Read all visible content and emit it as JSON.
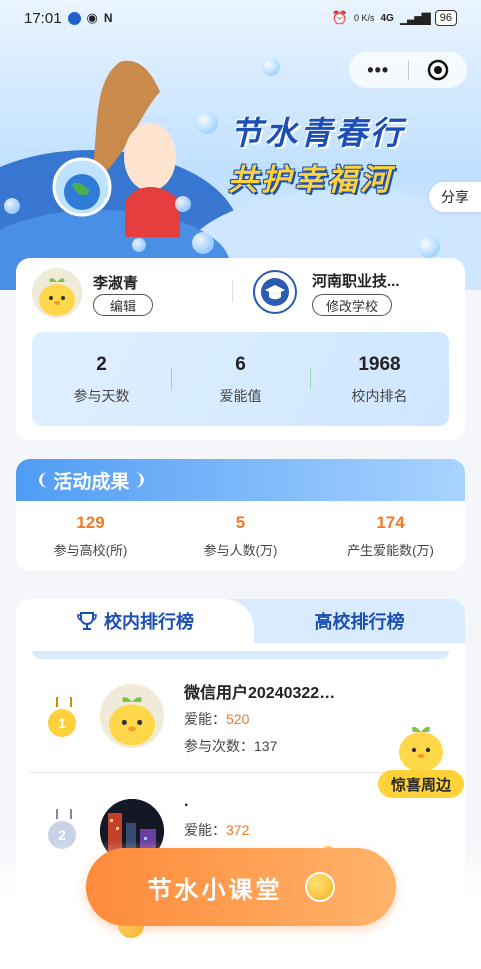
{
  "status_bar": {
    "time": "17:01",
    "signal": "4G",
    "speed": "0 K/s",
    "battery": "96"
  },
  "capsule": {
    "more": "•••"
  },
  "hero": {
    "title_line1": "节水青春行",
    "title_line2": "共护幸福河",
    "share_label": "分享"
  },
  "profile": {
    "user_name": "李淑青",
    "edit_label": "编辑",
    "school_name": "河南职业技...",
    "change_school_label": "修改学校",
    "stats": [
      {
        "value": "2",
        "label": "参与天数"
      },
      {
        "value": "6",
        "label": "爱能值"
      },
      {
        "value": "1968",
        "label": "校内排名"
      }
    ]
  },
  "results": {
    "title": "活动成果",
    "stats": [
      {
        "value": "129",
        "label": "参与高校(所)"
      },
      {
        "value": "5",
        "label": "参与人数(万)"
      },
      {
        "value": "174",
        "label": "产生爱能数(万)"
      }
    ]
  },
  "ranking": {
    "tab_active": "校内排行榜",
    "tab_inactive": "高校排行榜",
    "rows": [
      {
        "rank": "1",
        "name": "微信用户20240322…",
        "energy_label": "爱能：",
        "energy_value": "520",
        "count_label": "参与次数：",
        "count_value": "137"
      },
      {
        "rank": "2",
        "name": ".",
        "energy_label": "爱能：",
        "energy_value": "372"
      }
    ]
  },
  "surprise": {
    "label": "惊喜周边"
  },
  "bottom": {
    "class_label": "节水小课堂"
  },
  "colors": {
    "primary_blue": "#1b4fb5",
    "accent_orange": "#f07a26",
    "yellow": "#ffd23a"
  }
}
